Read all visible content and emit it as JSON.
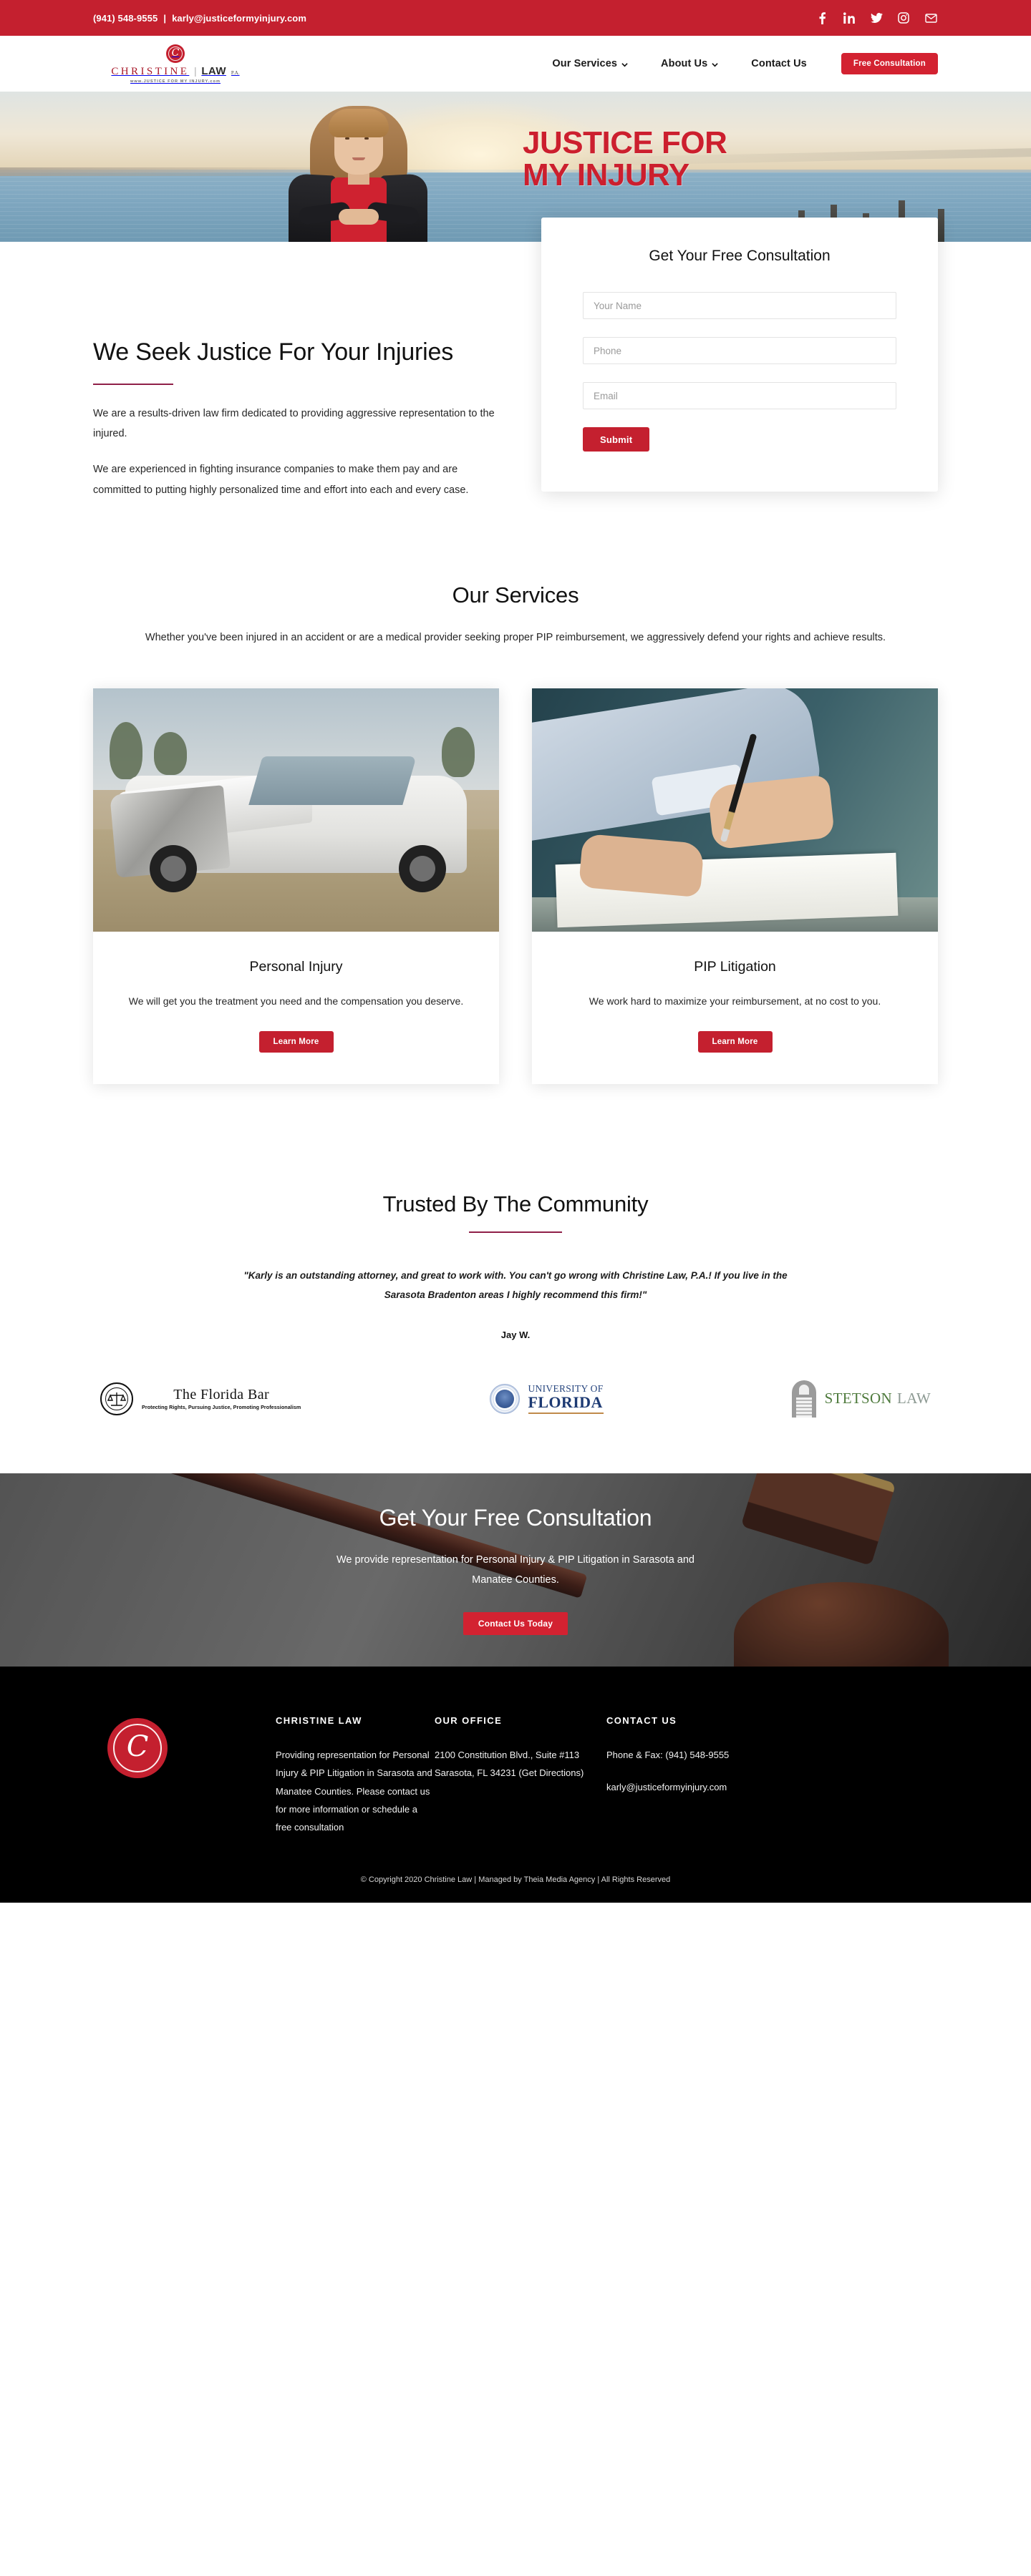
{
  "topbar": {
    "phone": "(941) 548-9555",
    "separator": "|",
    "email": "karly@justiceformyinjury.com",
    "social": [
      {
        "name": "facebook-icon",
        "label": "Facebook"
      },
      {
        "name": "linkedin-icon",
        "label": "LinkedIn"
      },
      {
        "name": "twitter-icon",
        "label": "Twitter"
      },
      {
        "name": "instagram-icon",
        "label": "Instagram"
      },
      {
        "name": "email-icon",
        "label": "Email"
      }
    ]
  },
  "header": {
    "logo": {
      "mark_letter": "C",
      "name": "CHRISTINE",
      "divider": "|",
      "law": "LAW",
      "suffix": "P.A.",
      "tagline": "www.JUSTICE FOR MY INJURY.com"
    },
    "nav": [
      {
        "label": "Our Services",
        "has_dropdown": true
      },
      {
        "label": "About Us",
        "has_dropdown": true
      },
      {
        "label": "Contact Us",
        "has_dropdown": false
      }
    ],
    "cta_label": "Free Consultation"
  },
  "hero": {
    "headline_line1": "JUSTICE FOR",
    "headline_line2": "MY INJURY"
  },
  "form": {
    "title": "Get Your Free Consultation",
    "fields": [
      {
        "name": "your-name",
        "placeholder": "Your Name",
        "value": ""
      },
      {
        "name": "phone",
        "placeholder": "Phone",
        "value": ""
      },
      {
        "name": "email",
        "placeholder": "Email",
        "value": ""
      }
    ],
    "submit_label": "Submit"
  },
  "intro": {
    "title": "We Seek Justice For Your Injuries",
    "paragraph1": "We are a results-driven law firm dedicated to providing aggressive representation to the injured.",
    "paragraph2": "We are experienced in fighting insurance companies to make them pay and are committed to putting highly personalized time and effort into each and every case."
  },
  "services": {
    "title": "Our Services",
    "subtitle": "Whether you've been injured in an accident or are a medical provider seeking proper PIP reimbursement, we aggressively defend your rights and achieve results.",
    "cards": [
      {
        "image_name": "wrecked-car-photo",
        "title": "Personal Injury",
        "text": "We will get you the treatment you need and the compensation you deserve.",
        "button_label": "Learn More"
      },
      {
        "image_name": "signing-document-photo",
        "title": "PIP Litigation",
        "text": "We work hard to maximize your reimbursement, at no cost to you.",
        "button_label": "Learn More"
      }
    ]
  },
  "trust": {
    "title": "Trusted By The Community",
    "quote": "\"Karly is an outstanding attorney, and great to work with. You can't go wrong with Christine Law, P.A.! If you live in the Sarasota Bradenton areas I highly recommend this firm!\"",
    "author": "Jay W.",
    "logos": [
      {
        "name": "florida-bar-logo",
        "primary": "The Florida Bar",
        "secondary": "Protecting Rights, Pursuing Justice, Promoting Professionalism"
      },
      {
        "name": "university-of-florida-logo",
        "primary": "UNIVERSITY OF",
        "secondary": "FLORIDA"
      },
      {
        "name": "stetson-law-logo",
        "primary": "STETSON",
        "secondary": "LAW"
      }
    ]
  },
  "cta": {
    "title": "Get Your Free Consultation",
    "subtitle": "We provide representation for Personal Injury & PIP Litigation in Sarasota and Manatee Counties.",
    "button_label": "Contact Us Today"
  },
  "footer": {
    "badge_letter": "C",
    "col1": {
      "heading": "CHRISTINE LAW",
      "text": "Providing representation for Personal Injury & PIP Litigation in Sarasota and Manatee Counties. Please contact us for more information or schedule a free consultation"
    },
    "col2": {
      "heading": "OUR OFFICE",
      "address": "2100 Constitution Blvd., Suite #113 Sarasota, FL 34231 (Get Directions)"
    },
    "col3": {
      "heading": "CONTACT US",
      "phone": "Phone & Fax: (941) 548-9555",
      "email": "karly@justiceformyinjury.com"
    },
    "copyright": "© Copyright 2020 Christine Law | Managed by Theia Media Agency | All Rights Reserved"
  },
  "colors": {
    "brand_red": "#c4202f",
    "button_red": "#d32231",
    "accent_maroon": "#8f2048",
    "footer_bg": "#000000"
  }
}
